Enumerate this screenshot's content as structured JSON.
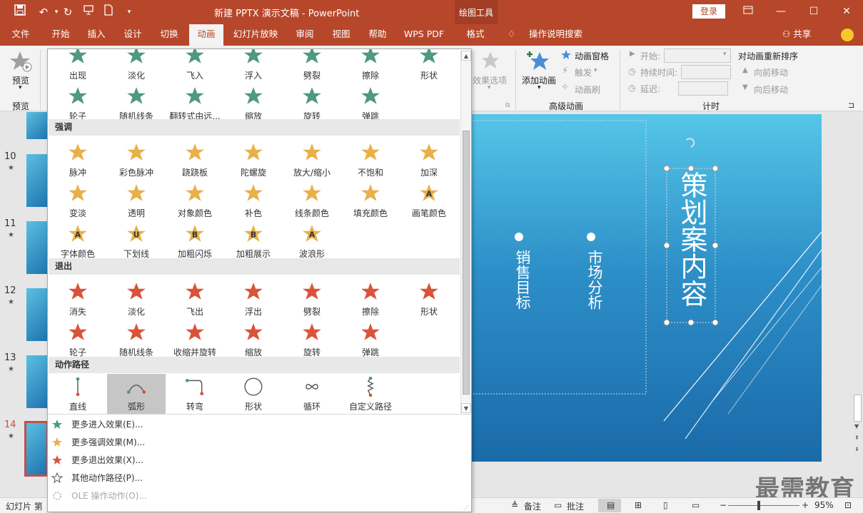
{
  "window": {
    "title": "新建 PPTX 演示文稿 - PowerPoint",
    "drawing_tools": "绘图工具",
    "login": "登录",
    "brand_color": "#b7472a"
  },
  "tabs": [
    "文件",
    "开始",
    "插入",
    "设计",
    "切换",
    "动画",
    "幻灯片放映",
    "审阅",
    "视图",
    "帮助",
    "WPS PDF",
    "格式"
  ],
  "tell_me": "操作说明搜索",
  "share": "共享",
  "ribbon": {
    "preview_label": "预览",
    "preview_group": "预览",
    "effect_options": "效果选项",
    "add_animation": "添加动画",
    "animation_pane": "动画窗格",
    "trigger": "触发",
    "animation_painter": "动画刷",
    "advanced_group": "高级动画",
    "start_label": "开始:",
    "duration_label": "持续时间:",
    "delay_label": "延迟:",
    "reorder_title": "对动画重新排序",
    "move_earlier": "向前移动",
    "move_later": "向后移动",
    "timing_group": "计时"
  },
  "thumbnails": {
    "numbers": [
      "10",
      "11",
      "12",
      "13",
      "14"
    ],
    "star": "★"
  },
  "gallery": {
    "entrance_row1": [
      "出现",
      "淡化",
      "飞入",
      "浮入",
      "劈裂",
      "擦除",
      "形状"
    ],
    "entrance_row2": [
      "轮子",
      "随机线条",
      "翻转式由远...",
      "缩放",
      "旋转",
      "弹跳"
    ],
    "emphasis_header": "强调",
    "emphasis_row1": [
      "脉冲",
      "彩色脉冲",
      "跷跷板",
      "陀螺旋",
      "放大/缩小",
      "不饱和",
      "加深"
    ],
    "emphasis_row2": [
      "变淡",
      "透明",
      "对象颜色",
      "补色",
      "线条颜色",
      "填充颜色",
      "画笔颜色"
    ],
    "emphasis_row3": [
      "字体颜色",
      "下划线",
      "加粗闪烁",
      "加粗展示",
      "波浪形"
    ],
    "emphasis_row3_letters": [
      "A",
      "U",
      "B",
      "B",
      "A"
    ],
    "emphasis_row2_letter": "A",
    "exit_header": "退出",
    "exit_row1": [
      "消失",
      "淡化",
      "飞出",
      "浮出",
      "劈裂",
      "擦除",
      "形状"
    ],
    "exit_row2": [
      "轮子",
      "随机线条",
      "收缩并旋转",
      "缩放",
      "旋转",
      "弹跳"
    ],
    "path_header": "动作路径",
    "path_row": [
      "直线",
      "弧形",
      "转弯",
      "形状",
      "循环",
      "自定义路径"
    ],
    "more_entrance": "更多进入效果(E)...",
    "more_emphasis": "更多强调效果(M)...",
    "more_exit": "更多退出效果(X)...",
    "more_paths": "其他动作路径(P)...",
    "ole_actions": "OLE 操作动作(O)...",
    "entrance_color": "#4e9a7e",
    "emphasis_color": "#e8b04a",
    "exit_color": "#d9533a"
  },
  "slide": {
    "title": "策划案内容",
    "bullet1": "销售目标",
    "bullet2": "市场分析"
  },
  "status": {
    "slide_label": "幻灯片 第",
    "notes": "备注",
    "comments": "批注",
    "zoom": "95%"
  },
  "watermark": "最需教育"
}
